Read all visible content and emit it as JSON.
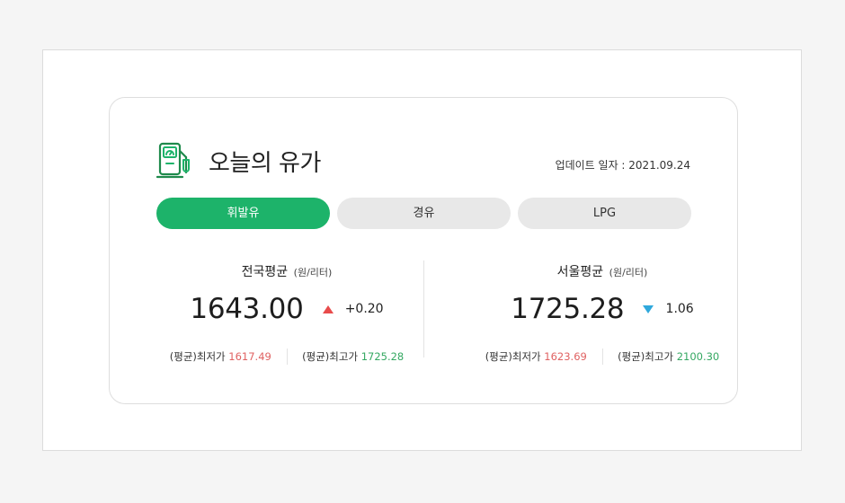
{
  "card": {
    "title": "오늘의 유가",
    "update_text": "업데이트 일자 : 2021.09.24",
    "icon": "gas-pump-icon",
    "accent_color": "#1db36a"
  },
  "tabs": [
    {
      "label": "휘발유",
      "active": true
    },
    {
      "label": "경유",
      "active": false
    },
    {
      "label": "LPG",
      "active": false
    }
  ],
  "national": {
    "title": "전국평균",
    "unit": "(원/리터)",
    "price": "1643.00",
    "change": "+0.20",
    "direction": "up",
    "min_label": "(평균)최저가",
    "min_value": "1617.49",
    "max_label": "(평균)최고가",
    "max_value": "1725.28"
  },
  "seoul": {
    "title": "서울평균",
    "unit": "(원/리터)",
    "price": "1725.28",
    "change": "1.06",
    "direction": "down",
    "min_label": "(평균)최저가",
    "min_value": "1623.69",
    "max_label": "(평균)최고가",
    "max_value": "2100.30"
  },
  "colors": {
    "up": "#e84b4b",
    "down": "#2fa8dc",
    "low": "#e06262",
    "high": "#35a862"
  }
}
